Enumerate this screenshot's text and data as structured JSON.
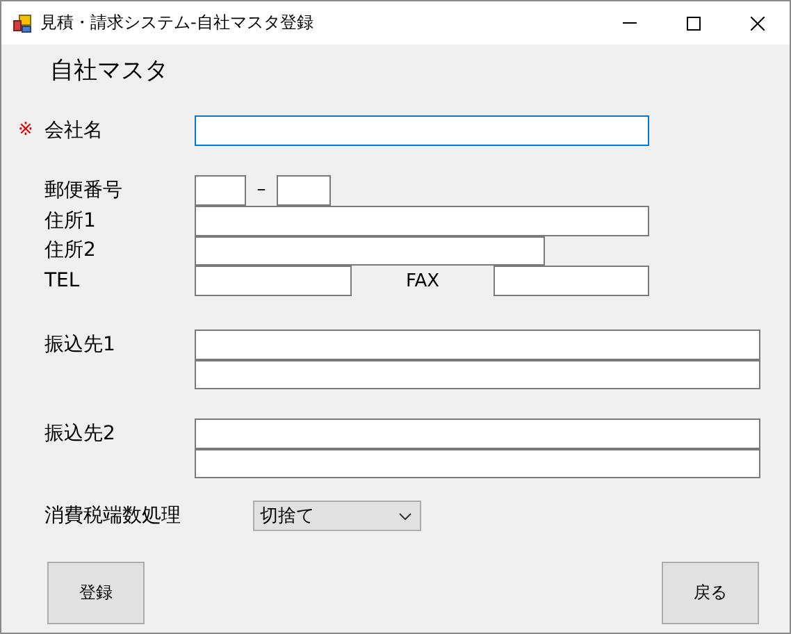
{
  "window": {
    "title": "見積・請求システム-自社マスタ登録"
  },
  "heading": "自社マスタ",
  "company": {
    "required_mark": "※",
    "label": "会社名",
    "focused": true
  },
  "postal": {
    "label": "郵便番号",
    "separator": "–"
  },
  "address1": {
    "label": "住所1"
  },
  "address2": {
    "label": "住所2"
  },
  "tel": {
    "label": "TEL",
    "fax_label": "FAX"
  },
  "transfer1": {
    "label": "振込先1"
  },
  "transfer2": {
    "label": "振込先2"
  },
  "tax_rounding": {
    "label": "消費税端数処理",
    "value": "切捨て"
  },
  "buttons": [
    "登録",
    "戻る"
  ]
}
